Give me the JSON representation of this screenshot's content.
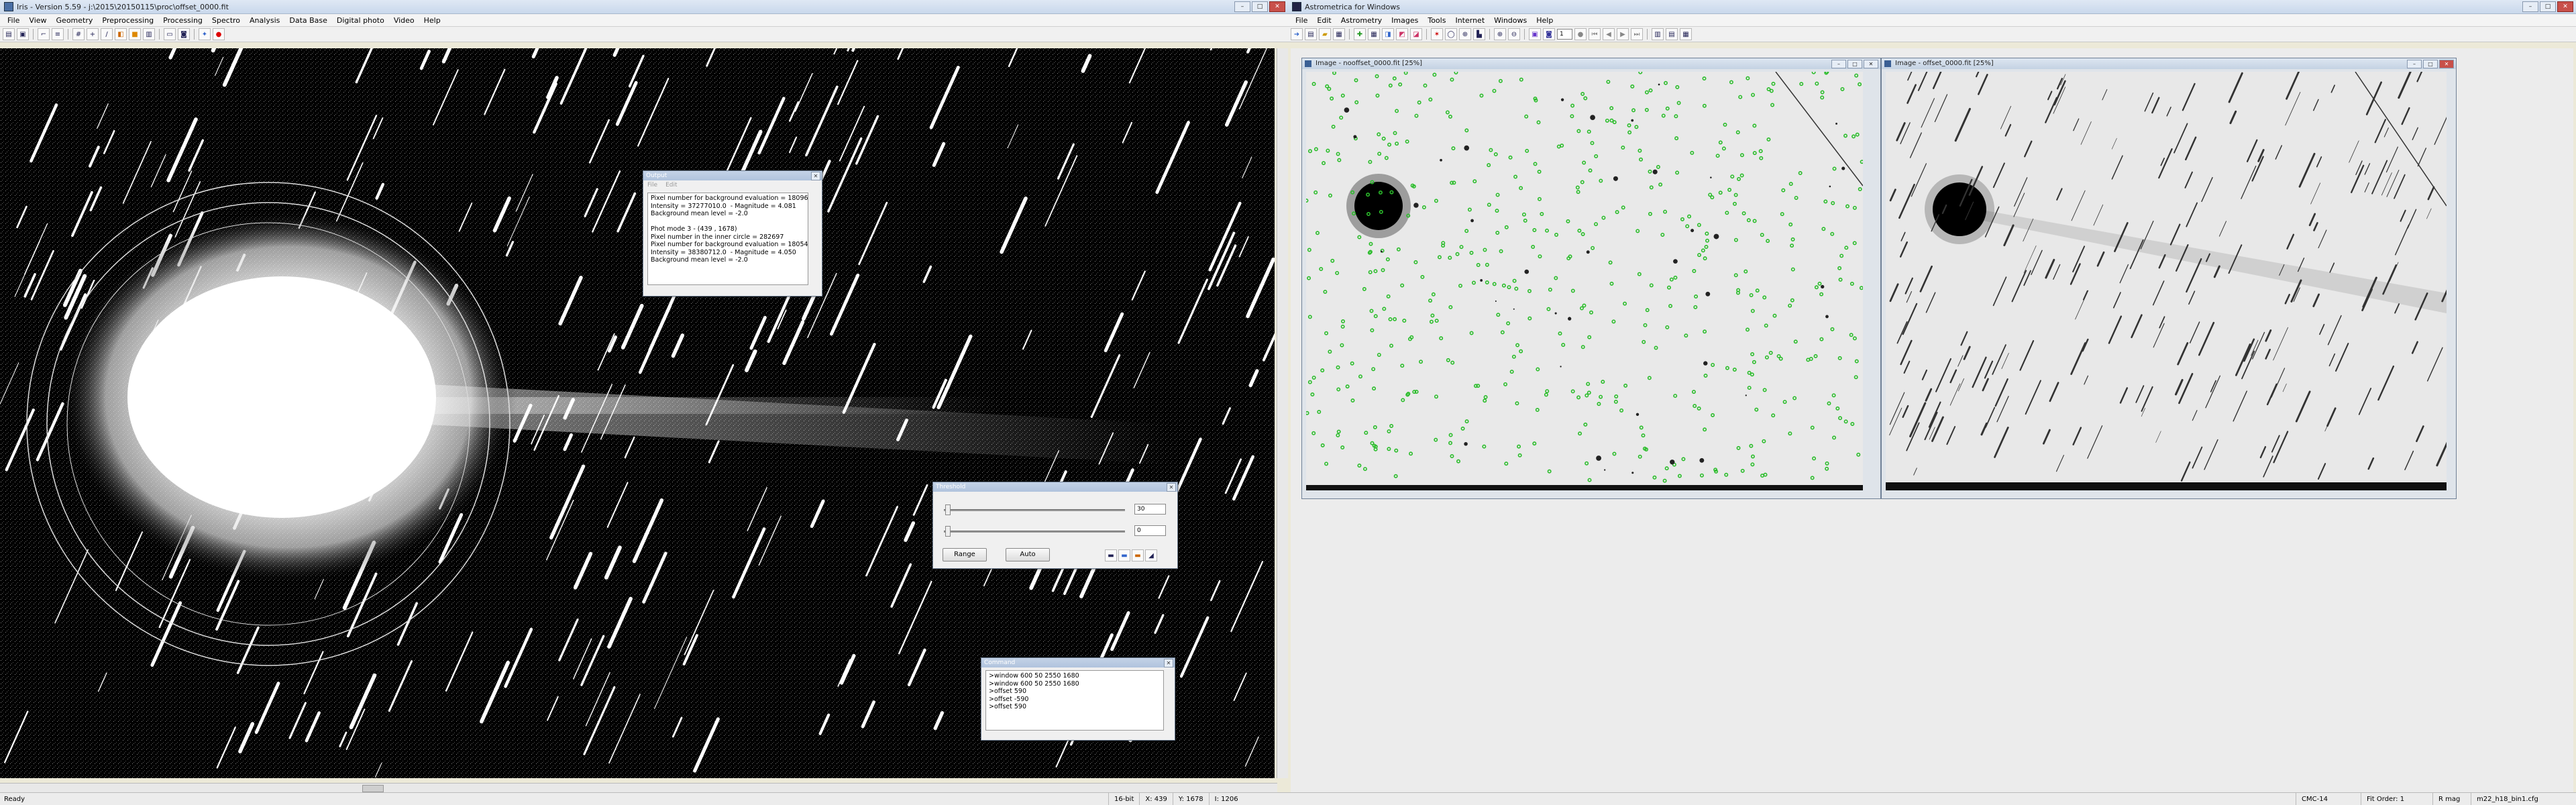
{
  "iris": {
    "title": "Iris - Version 5.59 - j:\\2015\\20150115\\proc\\offset_0000.fit",
    "menu": [
      "File",
      "View",
      "Geometry",
      "Preprocessing",
      "Processing",
      "Spectro",
      "Analysis",
      "Data Base",
      "Digital photo",
      "Video",
      "Help"
    ],
    "status_ready": "Ready",
    "status_depth": "16-bit",
    "status_x": "X: 439",
    "status_y": "Y: 1678",
    "status_val": "I: 1206",
    "output": {
      "title": "Output",
      "menu": [
        "File",
        "Edit"
      ],
      "text": "Pixel number for background evaluation = 18096\nIntensity = 37277010.0  - Magnitude = 4.081\nBackground mean level = -2.0\n\nPhot mode 3 - (439 , 1678)\nPixel number in the inner circle = 282697\nPixel number for background evaluation = 18054\nIntensity = 38380712.0  - Magnitude = 4.050\nBackground mean level = -2.0"
    },
    "threshold": {
      "title": "Threshold",
      "high": "30",
      "low": "0",
      "range_label": "Range",
      "auto_label": "Auto"
    },
    "command": {
      "title": "Command",
      "text": ">window 600 50 2550 1680\n>window 600 50 2550 1680\n>offset 590\n>offset -590\n>offset 590"
    }
  },
  "astro": {
    "title": "Astrometrica for Windows",
    "menu": [
      "File",
      "Edit",
      "Astrometry",
      "Images",
      "Tools",
      "Internet",
      "Windows",
      "Help"
    ],
    "spin_value": "1",
    "image1_title": "Image - nooffset_0000.fit [25%]",
    "image2_title": "Image - offset_0000.fit [25%]",
    "status": {
      "catalog": "CMC-14",
      "fit": "Fit Order: 1",
      "mag": "R mag",
      "cfg": "m22_h18_bin1.cfg"
    }
  }
}
